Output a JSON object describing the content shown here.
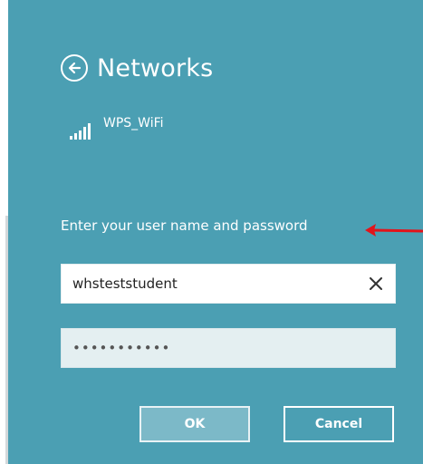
{
  "header": {
    "title": "Networks",
    "back_icon": "back-arrow-icon"
  },
  "network": {
    "name": "WPS_WiFi",
    "signal_icon": "wifi-signal-icon",
    "signal_bars": 5
  },
  "prompt": {
    "text": "Enter your user name and password"
  },
  "username": {
    "value": "whsteststudent",
    "clear_icon": "close-icon"
  },
  "password": {
    "value": "•••••••••••"
  },
  "buttons": {
    "ok_label": "OK",
    "cancel_label": "Cancel"
  },
  "colors": {
    "panel": "#4b9fb3",
    "ok_button": "#7cb9c8",
    "arrow": "#e2141b"
  }
}
